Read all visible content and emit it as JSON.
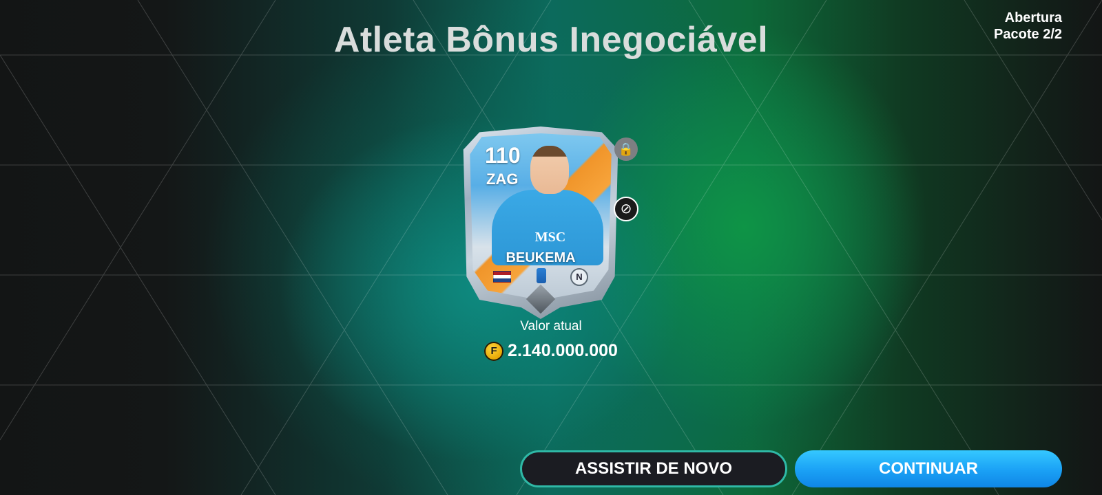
{
  "screen": {
    "title": "Atleta Bônus Inegociável",
    "pack_info_line1": "Abertura",
    "pack_info_line2": "Pacote 2/2"
  },
  "card": {
    "rating": "110",
    "position": "ZAG",
    "player_name": "BEUKEMA",
    "sponsor": "MSC",
    "club_initial": "N",
    "icons": [
      "lock-icon",
      "untradeable-icon",
      "netherlands-flag-icon",
      "league-badge-icon",
      "club-crest-icon"
    ]
  },
  "value": {
    "label": "Valor atual",
    "amount": "2.140.000.000",
    "currency_icon": "coin-icon"
  },
  "buttons": {
    "replay_label": "ASSISTIR DE NOVO",
    "continue_label": "CONTINUAR"
  },
  "colors": {
    "accent_teal": "#2fb8a6",
    "continue_blue": "#1aa0f5",
    "background_dark": "#121414"
  }
}
